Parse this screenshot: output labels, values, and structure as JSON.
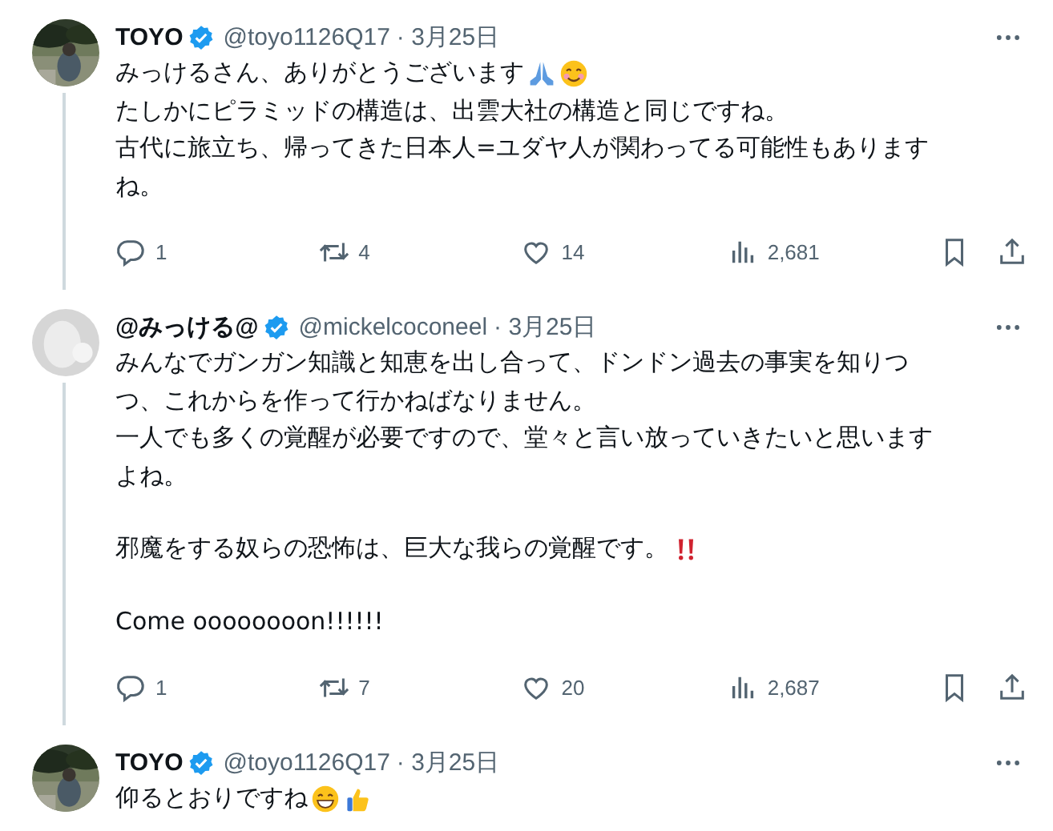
{
  "tweets": [
    {
      "avatar": {
        "kind": "picture"
      },
      "name": "TOYO",
      "verified": true,
      "handle": "@toyo1126Q17",
      "date": "· 3月25日",
      "thread_line": true,
      "lines": [
        {
          "text": "みっけるさん、ありがとうございます",
          "emoji": [
            {
              "kind": "pray"
            },
            {
              "kind": "smile"
            }
          ]
        },
        {
          "text": "たしかにピラミッドの構造は、出雲大社の構造と同じですね。"
        },
        {
          "text": "古代に旅立ち、帰ってきた日本人=ユダヤ人が関わってる可能性もあります"
        },
        {
          "text": "ね。"
        }
      ],
      "actions": [
        {
          "kind": "reply",
          "count": "1"
        },
        {
          "kind": "repost",
          "count": "4"
        },
        {
          "kind": "like",
          "count": "14"
        },
        {
          "kind": "views",
          "count": "2,681"
        },
        {
          "kind": "bookmark"
        },
        {
          "kind": "share"
        }
      ]
    },
    {
      "avatar": {
        "kind": "plain"
      },
      "name": "@みっける@",
      "verified": true,
      "handle": "@mickelcoconeel",
      "date": "· 3月25日",
      "thread_line": true,
      "lines": [
        {
          "text": "みんなでガンガン知識と知恵を出し合って、ドンドン過去の事実を知りつ"
        },
        {
          "text": "つ、これからを作って行かねばなりません。"
        },
        {
          "text": "一人でも多くの覚醒が必要ですので、堂々と言い放っていきたいと思います"
        },
        {
          "text": "よね。"
        },
        {
          "text": "邪魔をする奴らの恐怖は、巨大な我らの覚醒です。",
          "emoji": [
            {
              "kind": "bangbang"
            }
          ],
          "gap_before": true
        },
        {
          "text": "Come oooooooon!!!!!!",
          "gap_before": true
        }
      ],
      "actions": [
        {
          "kind": "reply",
          "count": "1"
        },
        {
          "kind": "repost",
          "count": "7"
        },
        {
          "kind": "like",
          "count": "20"
        },
        {
          "kind": "views",
          "count": "2,687"
        },
        {
          "kind": "bookmark"
        },
        {
          "kind": "share"
        }
      ]
    },
    {
      "avatar": {
        "kind": "picture"
      },
      "name": "TOYO",
      "verified": true,
      "handle": "@toyo1126Q17",
      "date": "· 3月25日",
      "thread_line": false,
      "lines": [
        {
          "text": "仰るとおりですね",
          "emoji": [
            {
              "kind": "grin"
            },
            {
              "kind": "thumbsup"
            }
          ]
        }
      ]
    }
  ]
}
